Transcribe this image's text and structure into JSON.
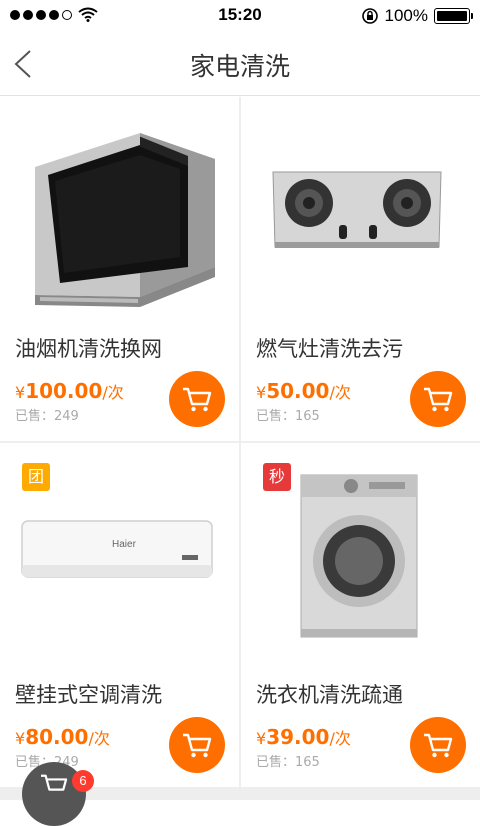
{
  "status_bar": {
    "time": "15:20",
    "battery": "100%",
    "icons": [
      "signal-dots-icon",
      "wifi-icon",
      "rotation-lock-icon",
      "battery-icon"
    ]
  },
  "navbar": {
    "title": "家电清洗",
    "back_icon": "chevron-left-icon"
  },
  "products": [
    {
      "name": "油烟机清洗换网",
      "price_symbol": "¥",
      "price": "100.00",
      "unit": "/次",
      "sold": "已售：249",
      "image_icon": "range-hood-image",
      "tag": ""
    },
    {
      "name": "燃气灶清洗去污",
      "price_symbol": "¥",
      "price": "50.00",
      "unit": "/次",
      "sold": "已售：165",
      "image_icon": "gas-stove-image",
      "tag": ""
    },
    {
      "name": "壁挂式空调清洗",
      "price_symbol": "¥",
      "price": "80.00",
      "unit": "/次",
      "sold": "已售：249",
      "image_icon": "air-conditioner-image",
      "tag": "团"
    },
    {
      "name": "洗衣机清洗疏通",
      "price_symbol": "¥",
      "price": "39.00",
      "unit": "/次",
      "sold": "已售：165",
      "image_icon": "washing-machine-image",
      "tag": "秒"
    }
  ],
  "ac_brand": "Haier",
  "floating_cart": {
    "badge": "6",
    "icon": "cart-icon"
  },
  "colors": {
    "accent": "#ff6f00",
    "tag_tuan": "#ffaa00",
    "tag_miao": "#e63a3a",
    "badge": "#ff3b30"
  }
}
